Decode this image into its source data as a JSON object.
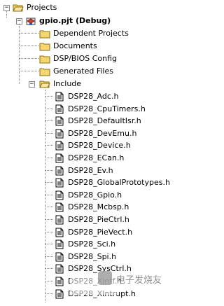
{
  "tree": {
    "root_label": "Projects",
    "project_label": "gpio.pjt (Debug)",
    "folders": [
      {
        "label": "Dependent Projects"
      },
      {
        "label": "Documents"
      },
      {
        "label": "DSP/BIOS Config"
      },
      {
        "label": "Generated Files"
      },
      {
        "label": "Include"
      }
    ],
    "include_files": [
      "DSP28_Adc.h",
      "DSP28_CpuTimers.h",
      "DSP28_DefaultIsr.h",
      "DSP28_DevEmu.h",
      "DSP28_Device.h",
      "DSP28_ECan.h",
      "DSP28_Ev.h",
      "DSP28_GlobalPrototypes.h",
      "DSP28_Gpio.h",
      "DSP28_Mcbsp.h",
      "DSP28_PieCtrl.h",
      "DSP28_PieVect.h",
      "DSP28_Sci.h",
      "DSP28_Spi.h",
      "DSP28_SysCtrl.h",
      "DSP28_Xintf.h",
      "DSP28_XIntrupt.h"
    ]
  },
  "watermark": {
    "text": "电子发烧友"
  },
  "colors": {
    "folder": "#f5d76e",
    "folder_edge": "#8a6d1a",
    "file_edge": "#000000"
  }
}
